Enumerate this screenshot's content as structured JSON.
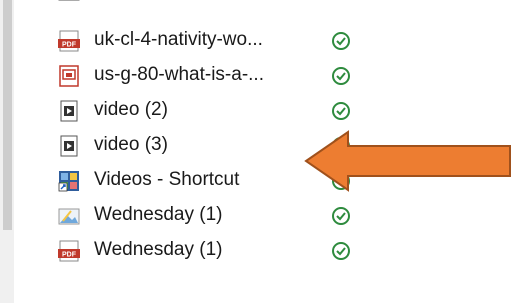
{
  "files": [
    {
      "name": "uk-cl-4-nativity-wo...",
      "type": "pdf-icon",
      "status": "synced-check-icon"
    },
    {
      "name": "us-g-80-what-is-a-...",
      "type": "presentation-file-icon",
      "status": "synced-check-icon"
    },
    {
      "name": "video (2)",
      "type": "video-file-icon",
      "status": "synced-check-icon"
    },
    {
      "name": "video (3)",
      "type": "video-file-icon",
      "status": "synced-check-icon"
    },
    {
      "name": "Videos - Shortcut",
      "type": "shortcut-icon",
      "status": "synced-check-icon"
    },
    {
      "name": "Wednesday (1)",
      "type": "image-file-icon",
      "status": "synced-check-icon"
    },
    {
      "name": "Wednesday (1)",
      "type": "pdf-icon",
      "status": "synced-check-icon"
    }
  ],
  "annotation": {
    "type": "orange-arrow",
    "color": "#ed7d31",
    "points_to": "video (3)"
  },
  "colors": {
    "pdf": "#c0392b",
    "status_green": "#2e8b3e",
    "arrow": "#ed7d31",
    "arrow_outline": "#a0511c"
  }
}
